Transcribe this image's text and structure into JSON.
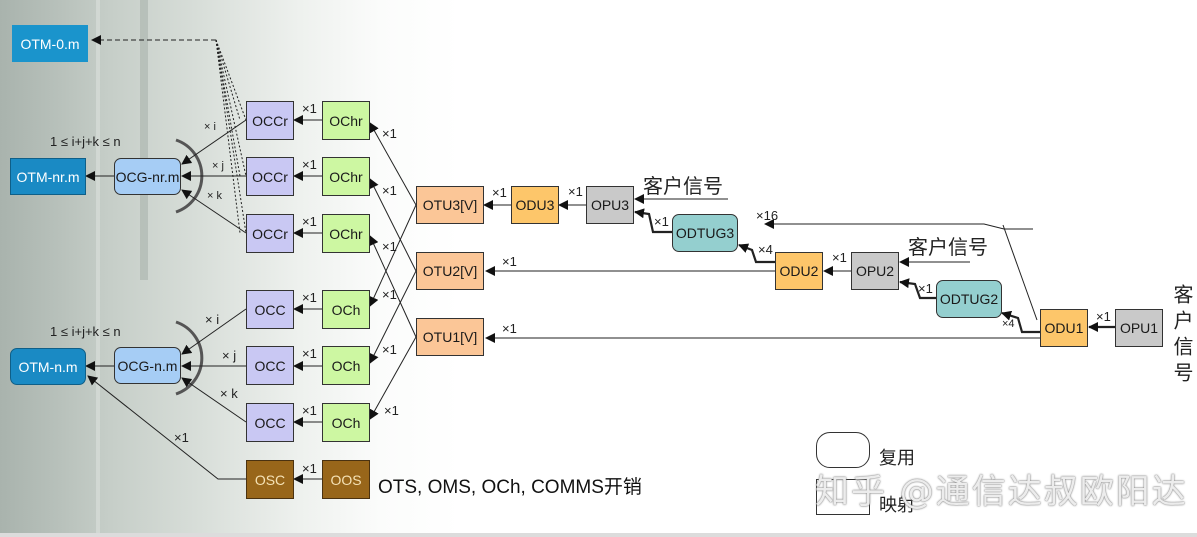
{
  "diagram": {
    "otm": {
      "otm0": "OTM-0.m",
      "otm_nr": "OTM-nr.m",
      "otm_n": "OTM-n.m"
    },
    "ocg": {
      "ocg_nr": "OCG-nr.m",
      "ocg_n": "OCG-n.m"
    },
    "constraint_top": "1 ≤ i+j+k ≤ n",
    "constraint_bottom": "1 ≤ i+j+k ≤ n",
    "occr": [
      "OCCr",
      "OCCr",
      "OCCr"
    ],
    "ochr": [
      "OChr",
      "OChr",
      "OChr"
    ],
    "occ": [
      "OCC",
      "OCC",
      "OCC"
    ],
    "och": [
      "OCh",
      "OCh",
      "OCh"
    ],
    "osc": "OSC",
    "oos": "OOS",
    "otu": [
      "OTU3[V]",
      "OTU2[V]",
      "OTU1[V]"
    ],
    "odu3": "ODU3",
    "opu3": "OPU3",
    "odtug3": "ODTUG3",
    "odu2": "ODU2",
    "opu2": "OPU2",
    "odtug2": "ODTUG2",
    "odu1": "ODU1",
    "opu1": "OPU1",
    "client_signal": "客户信号",
    "overhead_note": "OTS, OMS, OCh, COMMS开销",
    "multipliers": {
      "x1": "×1",
      "xi": "× i",
      "xj": "× j",
      "xk": "× k",
      "x4": "×4",
      "x16": "×16"
    }
  },
  "legend": {
    "multiplexing": "复用",
    "mapping": "映射"
  },
  "watermark": "知乎 @通信达叔欧阳达"
}
